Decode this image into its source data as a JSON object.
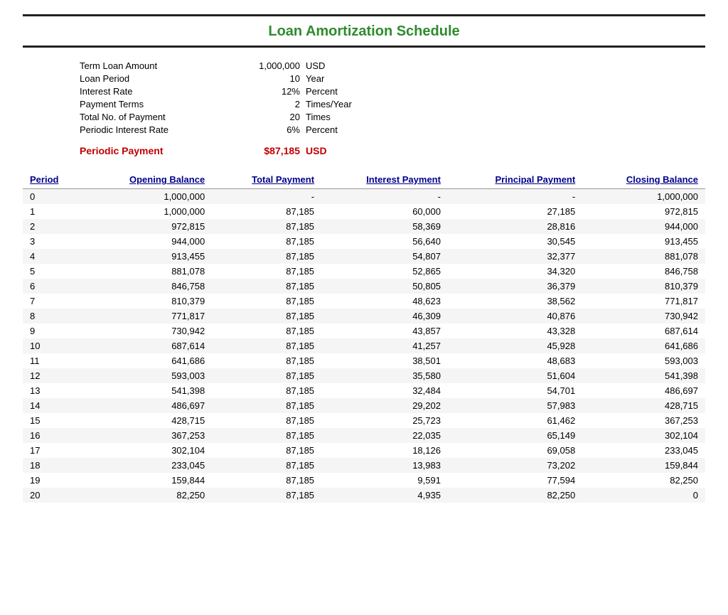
{
  "title": "Loan Amortization Schedule",
  "info": {
    "rows": [
      {
        "label": "Term Loan Amount",
        "value": "1,000,000",
        "unit": "USD"
      },
      {
        "label": "Loan Period",
        "value": "10",
        "unit": "Year"
      },
      {
        "label": "Interest Rate",
        "value": "12%",
        "unit": "Percent"
      },
      {
        "label": "Payment Terms",
        "value": "2",
        "unit": "Times/Year"
      },
      {
        "label": "Total No. of Payment",
        "value": "20",
        "unit": "Times"
      },
      {
        "label": "Periodic Interest Rate",
        "value": "6%",
        "unit": "Percent"
      }
    ],
    "periodic_label": "Periodic Payment",
    "periodic_value": "$87,185",
    "periodic_unit": "USD"
  },
  "table": {
    "headers": [
      "Period",
      "Opening Balance",
      "Total Payment",
      "Interest Payment",
      "Principal Payment",
      "Closing Balance"
    ],
    "rows": [
      [
        0,
        "1,000,000",
        "-",
        "-",
        "-",
        "1,000,000"
      ],
      [
        1,
        "1,000,000",
        "87,185",
        "60,000",
        "27,185",
        "972,815"
      ],
      [
        2,
        "972,815",
        "87,185",
        "58,369",
        "28,816",
        "944,000"
      ],
      [
        3,
        "944,000",
        "87,185",
        "56,640",
        "30,545",
        "913,455"
      ],
      [
        4,
        "913,455",
        "87,185",
        "54,807",
        "32,377",
        "881,078"
      ],
      [
        5,
        "881,078",
        "87,185",
        "52,865",
        "34,320",
        "846,758"
      ],
      [
        6,
        "846,758",
        "87,185",
        "50,805",
        "36,379",
        "810,379"
      ],
      [
        7,
        "810,379",
        "87,185",
        "48,623",
        "38,562",
        "771,817"
      ],
      [
        8,
        "771,817",
        "87,185",
        "46,309",
        "40,876",
        "730,942"
      ],
      [
        9,
        "730,942",
        "87,185",
        "43,857",
        "43,328",
        "687,614"
      ],
      [
        10,
        "687,614",
        "87,185",
        "41,257",
        "45,928",
        "641,686"
      ],
      [
        11,
        "641,686",
        "87,185",
        "38,501",
        "48,683",
        "593,003"
      ],
      [
        12,
        "593,003",
        "87,185",
        "35,580",
        "51,604",
        "541,398"
      ],
      [
        13,
        "541,398",
        "87,185",
        "32,484",
        "54,701",
        "486,697"
      ],
      [
        14,
        "486,697",
        "87,185",
        "29,202",
        "57,983",
        "428,715"
      ],
      [
        15,
        "428,715",
        "87,185",
        "25,723",
        "61,462",
        "367,253"
      ],
      [
        16,
        "367,253",
        "87,185",
        "22,035",
        "65,149",
        "302,104"
      ],
      [
        17,
        "302,104",
        "87,185",
        "18,126",
        "69,058",
        "233,045"
      ],
      [
        18,
        "233,045",
        "87,185",
        "13,983",
        "73,202",
        "159,844"
      ],
      [
        19,
        "159,844",
        "87,185",
        "9,591",
        "77,594",
        "82,250"
      ],
      [
        20,
        "82,250",
        "87,185",
        "4,935",
        "82,250",
        "0"
      ]
    ]
  }
}
